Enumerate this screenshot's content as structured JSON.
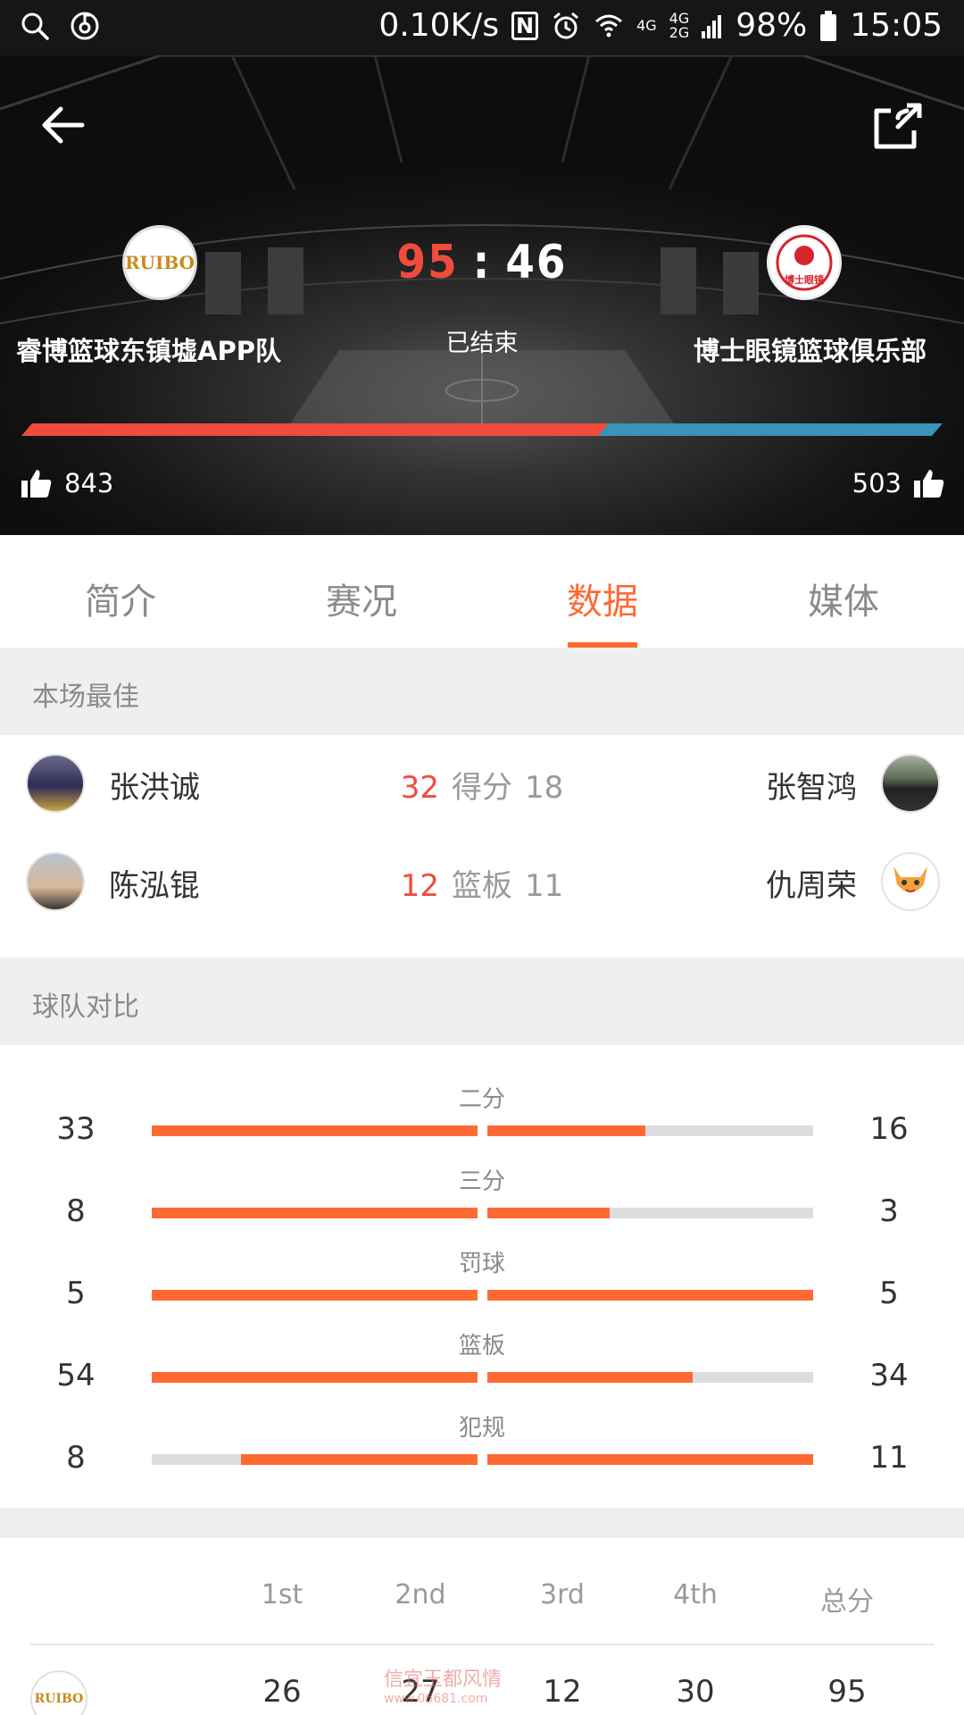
{
  "status_bar": {
    "net_speed": "0.10K/s",
    "nfc": "N",
    "signal_label_top": "4G",
    "signal_label_mid": "4G",
    "signal_label_bottom": "2G",
    "battery": "98%",
    "time": "15:05"
  },
  "match": {
    "home_team": "睿博篮球东镇墟APP队",
    "away_team": "博士眼镜篮球俱乐部",
    "home_logo_text": "RUIBO",
    "away_logo_text": "博士眼镜",
    "home_score": "95",
    "separator": ":",
    "away_score": "46",
    "status": "已结束",
    "home_likes": "843",
    "away_likes": "503",
    "home_support_fraction": 0.626,
    "colors": {
      "home": "#f04c3e",
      "away": "#3a93b8"
    }
  },
  "tabs": [
    {
      "label": "简介",
      "active": false
    },
    {
      "label": "赛况",
      "active": false
    },
    {
      "label": "数据",
      "active": true
    },
    {
      "label": "媒体",
      "active": false
    }
  ],
  "best": {
    "title": "本场最佳",
    "rows": [
      {
        "home_player": "张洪诚",
        "home_value": "32",
        "stat": "得分",
        "away_value": "18",
        "away_player": "张智鸿"
      },
      {
        "home_player": "陈泓锟",
        "home_value": "12",
        "stat": "篮板",
        "away_value": "11",
        "away_player": "仇周荣"
      }
    ]
  },
  "compare": {
    "title": "球队对比",
    "rows": [
      {
        "label": "二分",
        "home": "33",
        "away": "16",
        "home_frac": 1.0,
        "away_frac": 0.485
      },
      {
        "label": "三分",
        "home": "8",
        "away": "3",
        "home_frac": 1.0,
        "away_frac": 0.375
      },
      {
        "label": "罚球",
        "home": "5",
        "away": "5",
        "home_frac": 1.0,
        "away_frac": 1.0
      },
      {
        "label": "篮板",
        "home": "54",
        "away": "34",
        "home_frac": 1.0,
        "away_frac": 0.63
      },
      {
        "label": "犯规",
        "home": "8",
        "away": "11",
        "home_frac": 0.727,
        "away_frac": 1.0
      }
    ],
    "accent": "#ff6a33"
  },
  "quarters": {
    "headers": [
      "1st",
      "2nd",
      "3rd",
      "4th",
      "总分"
    ],
    "home_row": [
      "26",
      "27",
      "12",
      "30",
      "95"
    ]
  },
  "watermark": {
    "line1": "信宜玉都风情",
    "line2": "www.06681.com"
  }
}
